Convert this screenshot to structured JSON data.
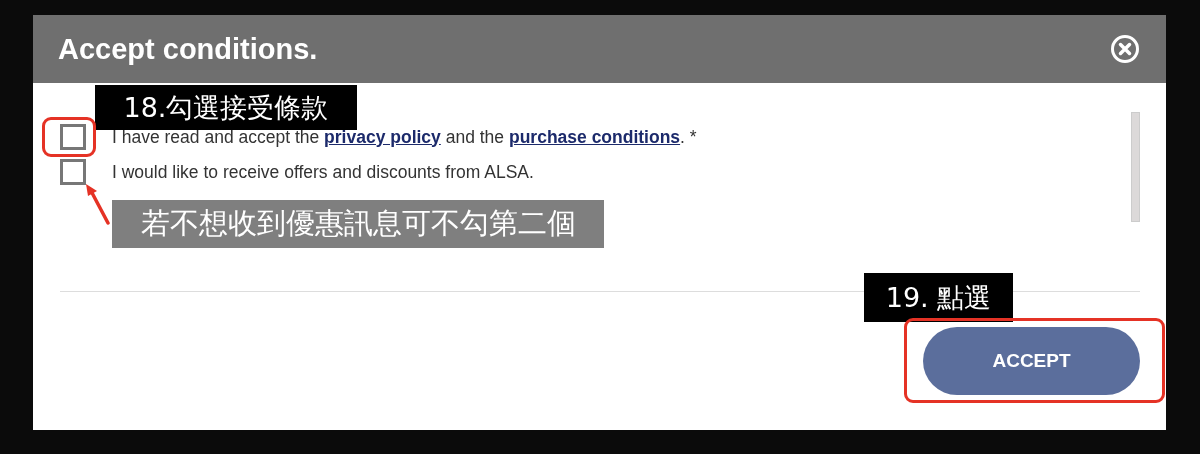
{
  "dialog": {
    "title": "Accept conditions.",
    "checkboxes": [
      {
        "checked": false,
        "parts": [
          {
            "kind": "text",
            "text": "I have read and accept the "
          },
          {
            "kind": "link",
            "text": "privacy policy"
          },
          {
            "kind": "text",
            "text": " and the "
          },
          {
            "kind": "link",
            "text": "purchase conditions"
          },
          {
            "kind": "text",
            "text": ". *"
          }
        ]
      },
      {
        "checked": false,
        "parts": [
          {
            "kind": "text",
            "text": "I would like to receive offers and discounts from ALSA."
          }
        ]
      }
    ],
    "button": "ACCEPT"
  },
  "annotations": [
    {
      "kind": "label",
      "text": "18.勾選接受條款"
    },
    {
      "kind": "highlight"
    },
    {
      "kind": "arrow"
    },
    {
      "kind": "note",
      "text": "若不想收到優惠訊息可不勾第二個"
    },
    {
      "kind": "label",
      "text": "19. 點選"
    },
    {
      "kind": "highlight"
    }
  ]
}
